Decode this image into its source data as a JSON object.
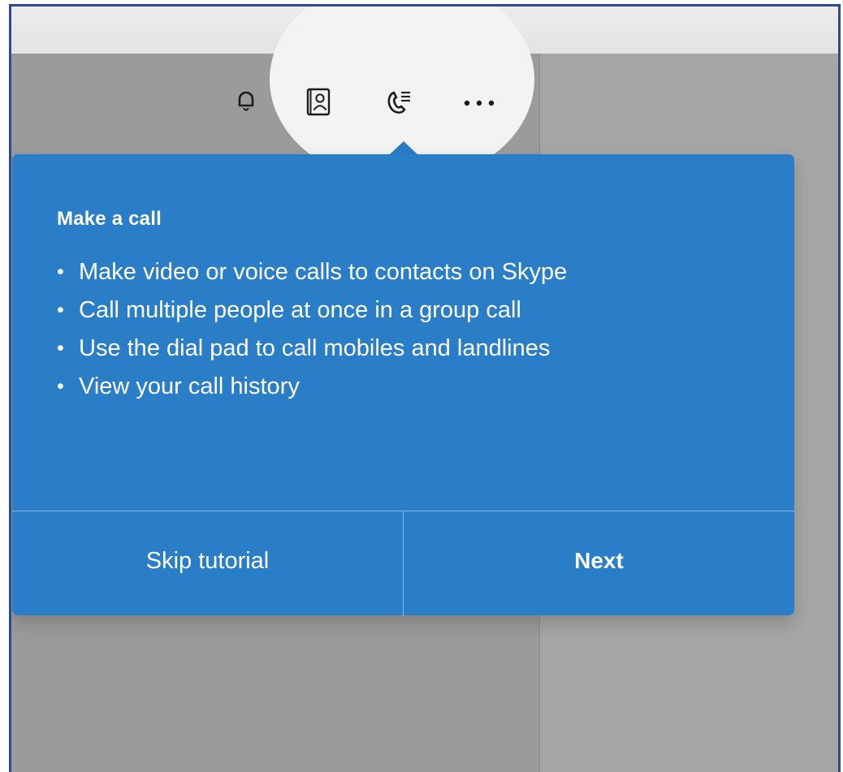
{
  "toolbar": {
    "icons": [
      {
        "name": "bell-icon"
      },
      {
        "name": "contacts-icon"
      },
      {
        "name": "call-history-icon"
      },
      {
        "name": "more-options-icon"
      }
    ]
  },
  "tutorial": {
    "title": "Make a call",
    "bullets": [
      "Make video or voice calls to contacts on Skype",
      "Call multiple people at once in a group call",
      "Use the dial pad to call mobiles and landlines",
      "View your call history"
    ],
    "skip_label": "Skip tutorial",
    "next_label": "Next"
  },
  "colors": {
    "tooltip_background": "#2a7dc7",
    "overlay": "#9b9b9b",
    "spotlight": "#f3f3f3"
  }
}
